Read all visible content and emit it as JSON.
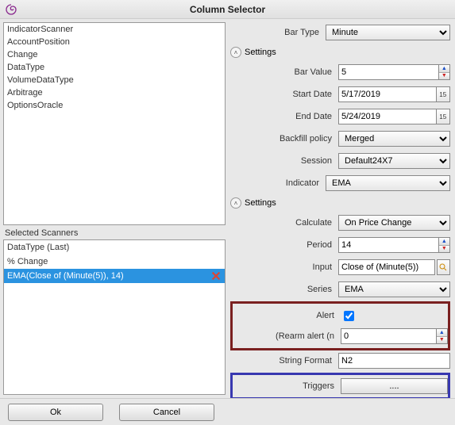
{
  "title": "Column Selector",
  "scanners": {
    "items": [
      "IndicatorScanner",
      "AccountPosition",
      "Change",
      "DataType",
      "VolumeDataType",
      "Arbitrage",
      "OptionsOracle"
    ],
    "selected_label": "Selected Scanners",
    "selected": [
      {
        "label": "DataType (Last)",
        "sel": false
      },
      {
        "label": "% Change",
        "sel": false
      },
      {
        "label": "EMA(Close of (Minute(5)), 14)",
        "sel": true
      }
    ]
  },
  "form": {
    "bar_type_label": "Bar Type",
    "bar_type": "Minute",
    "settings_label": "Settings",
    "bar_value_label": "Bar Value",
    "bar_value": "5",
    "start_date_label": "Start Date",
    "start_date": "5/17/2019",
    "end_date_label": "End Date",
    "end_date": "5/24/2019",
    "backfill_label": "Backfill policy",
    "backfill": "Merged",
    "session_label": "Session",
    "session": "Default24X7",
    "indicator_label": "Indicator",
    "indicator": "EMA",
    "calculate_label": "Calculate",
    "calculate": "On Price Change",
    "period_label": "Period",
    "period": "14",
    "input_label": "Input",
    "input": "Close of (Minute(5))",
    "series_label": "Series",
    "series": "EMA",
    "alert_label": "Alert",
    "alert_checked": true,
    "rearm_label": "(Rearm alert (n",
    "rearm": "0",
    "strfmt_label": "String Format",
    "strfmt": "N2",
    "triggers_label": "Triggers",
    "triggers_btn": "...."
  },
  "buttons": {
    "ok": "Ok",
    "cancel": "Cancel"
  }
}
